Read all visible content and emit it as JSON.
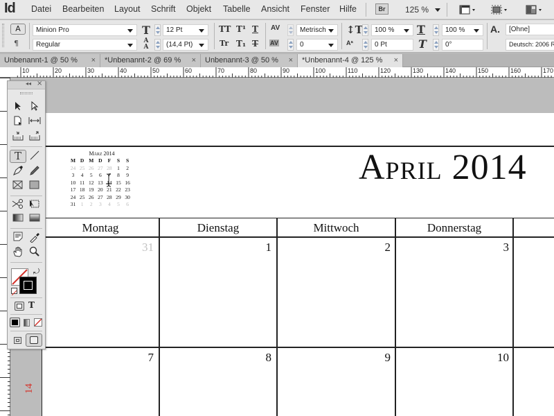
{
  "app": {
    "logo": "Id"
  },
  "menu": [
    "Datei",
    "Bearbeiten",
    "Layout",
    "Schrift",
    "Objekt",
    "Tabelle",
    "Ansicht",
    "Fenster",
    "Hilfe"
  ],
  "menubar_right": {
    "bridge_label": "Br",
    "zoom": "125 %"
  },
  "control": {
    "font_family": "Minion Pro",
    "font_style": "Regular",
    "font_size": "12 Pt",
    "leading": "(14,4 Pt)",
    "kerning": "Metrisch",
    "tracking": "0",
    "vertical_scale": "100 %",
    "baseline_shift": "0 Pt",
    "horizontal_scale": "100 %",
    "skew": "0°",
    "char_style": "[Ohne]",
    "language": "Deutsch: 2006 R",
    "icons": {
      "allcaps": "TT",
      "superscript": "T¹",
      "underline": "T",
      "smallcaps": "Tr",
      "subscript": "T₁",
      "strikethrough": "T"
    }
  },
  "tabs": [
    {
      "label": "Unbenannt-1 @ 50 %",
      "active": false
    },
    {
      "label": "*Unbenannt-2 @ 69 %",
      "active": false
    },
    {
      "label": "Unbenannt-3 @ 50 %",
      "active": false
    },
    {
      "label": "*Unbenannt-4 @ 125 %",
      "active": true
    }
  ],
  "ruler": {
    "h_labels": [
      "10",
      "20",
      "30",
      "40",
      "50",
      "60",
      "70",
      "80",
      "90",
      "100",
      "110",
      "120",
      "130",
      "140",
      "150",
      "160",
      "170"
    ]
  },
  "document": {
    "month_title": "April 2014",
    "weekdays": [
      "Montag",
      "Dienstag",
      "Mittwoch",
      "Donnerstag"
    ],
    "week1": [
      {
        "n": "31",
        "muted": true
      },
      {
        "n": "1"
      },
      {
        "n": "2"
      },
      {
        "n": "3"
      }
    ],
    "week2": [
      {
        "n": "7"
      },
      {
        "n": "8"
      },
      {
        "n": "9"
      },
      {
        "n": "10"
      }
    ],
    "side_label": "14",
    "mini_calendar": {
      "title": "März 2014",
      "headers": [
        "M",
        "D",
        "M",
        "D",
        "F",
        "S",
        "S"
      ],
      "rows": [
        [
          "24",
          "25",
          "26",
          "27",
          "28",
          "1",
          "2"
        ],
        [
          "3",
          "4",
          "5",
          "6",
          "7",
          "8",
          "9"
        ],
        [
          "10",
          "11",
          "12",
          "13",
          "14",
          "15",
          "16"
        ],
        [
          "17",
          "18",
          "19",
          "20",
          "21",
          "22",
          "23"
        ],
        [
          "24",
          "25",
          "26",
          "27",
          "28",
          "29",
          "30"
        ],
        [
          "31",
          "1",
          "2",
          "3",
          "4",
          "5",
          "6"
        ]
      ],
      "muted_first_row_count": 5,
      "muted_last_row_from": 1
    }
  },
  "tools": {
    "text_tool_glyph": "T",
    "format_text_glyph": "T"
  },
  "colors": {
    "accent_red": "#d4342c"
  }
}
